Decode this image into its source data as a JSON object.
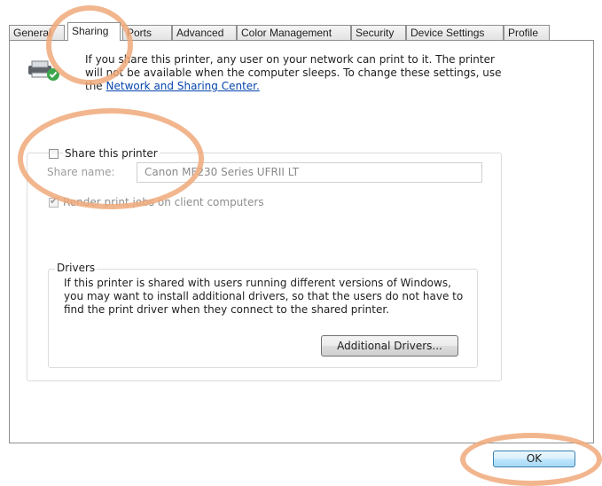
{
  "tabs": [
    "General",
    "Sharing",
    "Ports",
    "Advanced",
    "Color Management",
    "Security",
    "Device Settings",
    "Profile"
  ],
  "active_tab": "Sharing",
  "info": {
    "text": "If you share this printer, any user on your network can print to it. The printer will not be available when the computer sleeps. To change these settings, use the",
    "link_text": "Network and Sharing Center.",
    "icon": "shared-printer-icon"
  },
  "share": {
    "checkbox_label": "Share this printer",
    "checked": false,
    "share_name_label": "Share name:",
    "share_name_value": "Canon MF230 Series UFRII LT",
    "render_label": "Render print jobs on client computers",
    "render_checked": true
  },
  "drivers": {
    "title": "Drivers",
    "text": "If this printer is shared with users running different versions of Windows, you may want to install additional drivers, so that the users do not have to find the print driver when they connect to the shared printer.",
    "button_label": "Additional Drivers..."
  },
  "footer": {
    "ok_label": "OK"
  },
  "colors": {
    "annotation": "#f0a97a",
    "link": "#0645ad",
    "ok_border": "#3c7fb1"
  }
}
